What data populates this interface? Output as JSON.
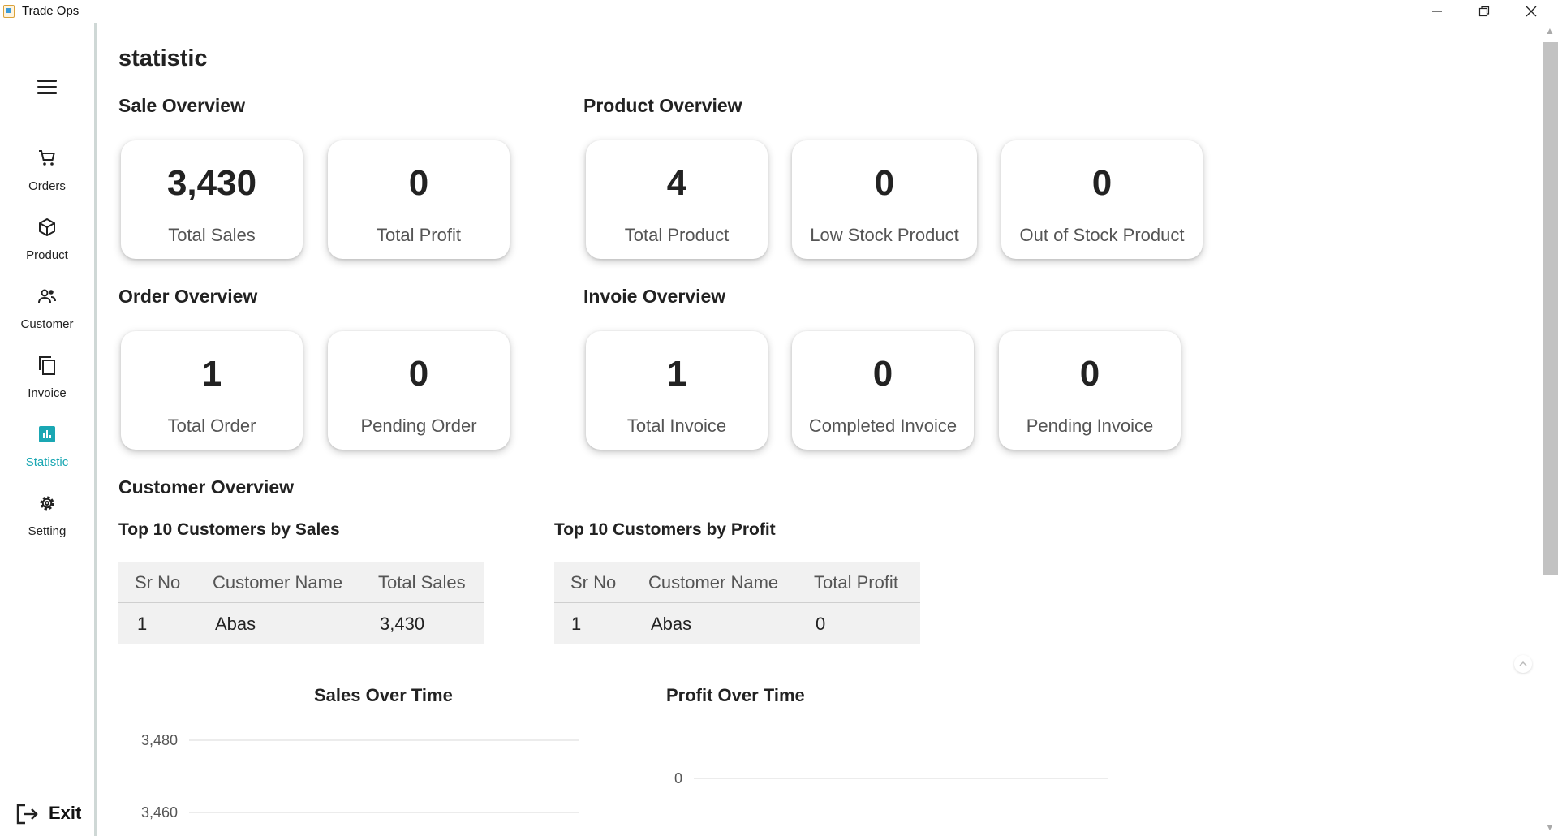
{
  "window": {
    "title": "Trade Ops",
    "icons": {
      "minimize": "minimize-icon",
      "maximize": "restore-icon",
      "close": "close-icon"
    }
  },
  "sidebar": {
    "menu_icon": "hamburger-menu-icon",
    "items": [
      {
        "label": "Orders",
        "icon": "cart-icon",
        "active": false
      },
      {
        "label": "Product",
        "icon": "box-icon",
        "active": false
      },
      {
        "label": "Customer",
        "icon": "people-icon",
        "active": false
      },
      {
        "label": "Invoice",
        "icon": "copy-icon",
        "active": false
      },
      {
        "label": "Statistic",
        "icon": "bar-chart-icon",
        "active": true
      },
      {
        "label": "Setting",
        "icon": "gear-icon",
        "active": false
      }
    ],
    "exit_label": "Exit",
    "accent_color": "#1aa7b3"
  },
  "main": {
    "page_title": "statistic",
    "sale_overview": {
      "title": "Sale Overview",
      "cards": [
        {
          "value": "3,430",
          "label": "Total Sales"
        },
        {
          "value": "0",
          "label": "Total Profit"
        }
      ]
    },
    "product_overview": {
      "title": "Product Overview",
      "cards": [
        {
          "value": "4",
          "label": "Total Product"
        },
        {
          "value": "0",
          "label": "Low Stock Product"
        },
        {
          "value": "0",
          "label": "Out of Stock Product"
        }
      ]
    },
    "order_overview": {
      "title": "Order Overview",
      "cards": [
        {
          "value": "1",
          "label": "Total Order"
        },
        {
          "value": "0",
          "label": "Pending Order"
        }
      ]
    },
    "invoice_overview": {
      "title": "Invoie Overview",
      "cards": [
        {
          "value": "1",
          "label": "Total Invoice"
        },
        {
          "value": "0",
          "label": "Completed Invoice"
        },
        {
          "value": "0",
          "label": "Pending Invoice"
        }
      ]
    },
    "customer_overview": {
      "title": "Customer Overview",
      "by_sales": {
        "title": "Top 10 Customers by Sales",
        "headers": [
          "Sr No",
          "Customer Name",
          "Total Sales"
        ],
        "rows": [
          [
            "1",
            "Abas",
            "3,430"
          ]
        ]
      },
      "by_profit": {
        "title": "Top 10 Customers by Profit",
        "headers": [
          "Sr No",
          "Customer Name",
          "Total Profit"
        ],
        "rows": [
          [
            "1",
            "Abas",
            "0"
          ]
        ]
      }
    }
  },
  "chart_data": [
    {
      "type": "line",
      "title": "Sales Over Time",
      "xlabel": "",
      "ylabel": "",
      "y_ticks": [
        "3,480",
        "3,460"
      ],
      "grid": true
    },
    {
      "type": "line",
      "title": "Profit Over Time",
      "xlabel": "",
      "ylabel": "",
      "y_ticks": [
        "0"
      ],
      "grid": true
    }
  ]
}
